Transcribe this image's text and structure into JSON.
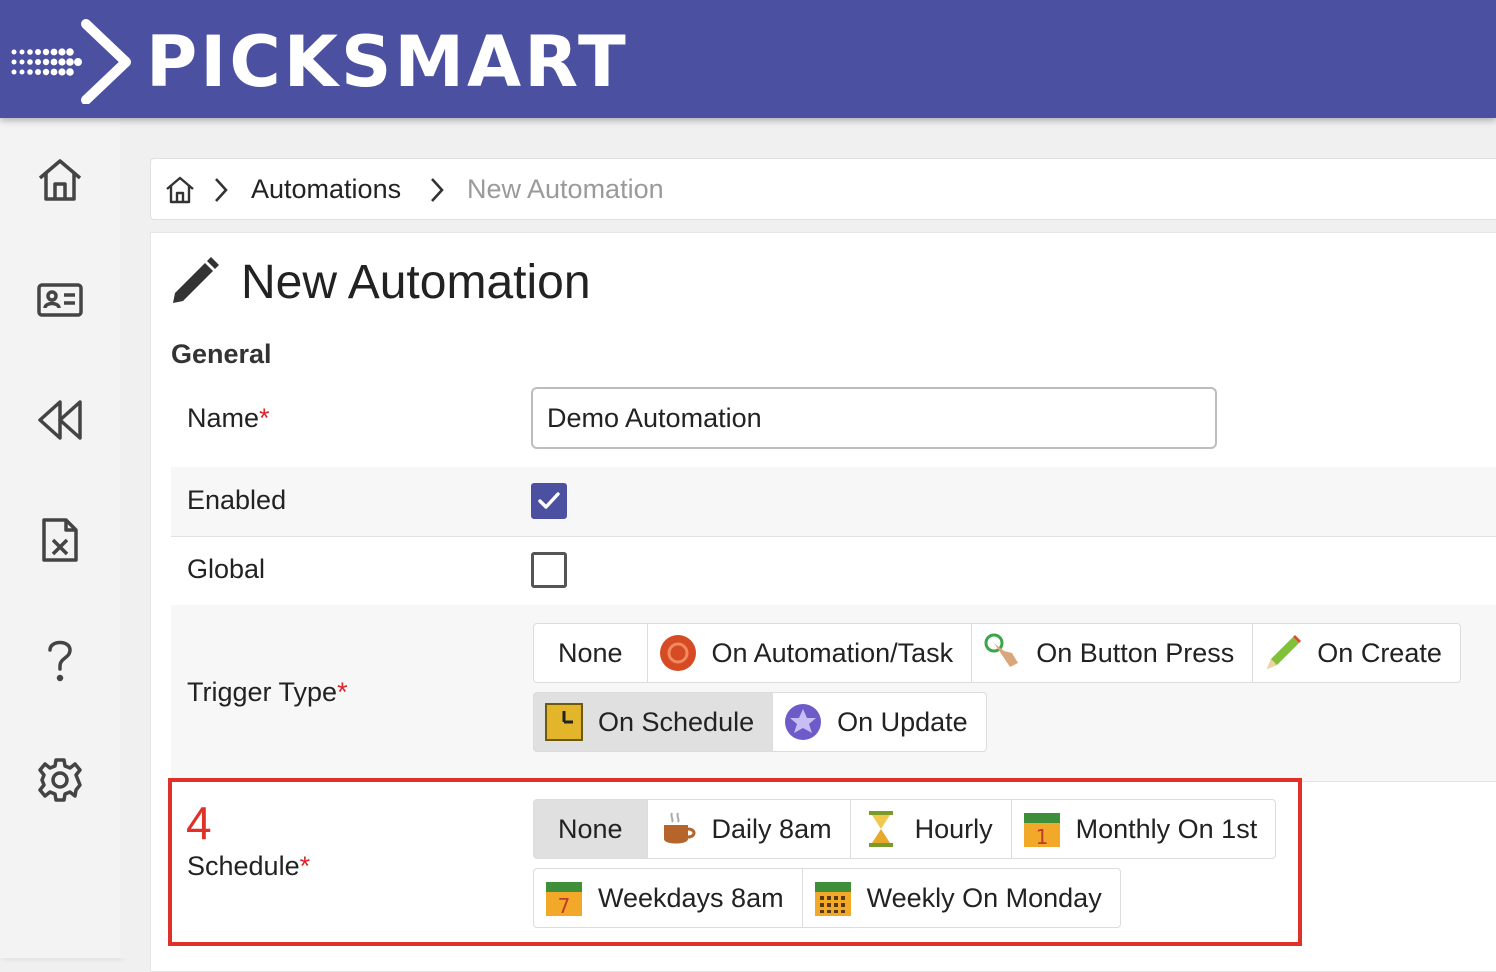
{
  "app": {
    "brand": "PICKSMART"
  },
  "sidebar": {
    "items": [
      {
        "icon": "home-icon"
      },
      {
        "icon": "id-card-icon"
      },
      {
        "icon": "rewind-icon"
      },
      {
        "icon": "excel-file-icon"
      },
      {
        "icon": "help-icon"
      },
      {
        "icon": "gear-icon"
      }
    ]
  },
  "breadcrumb": {
    "items": [
      "Automations",
      "New Automation"
    ]
  },
  "page": {
    "title": "New Automation",
    "section": "General"
  },
  "form": {
    "name_label": "Name",
    "name_value": "Demo Automation",
    "required_mark": "*",
    "enabled_label": "Enabled",
    "enabled": true,
    "global_label": "Global",
    "global": false,
    "trigger_label": "Trigger Type",
    "trigger_options": [
      {
        "label": "None",
        "icon": ""
      },
      {
        "label": "On Automation/Task",
        "icon": "record-icon"
      },
      {
        "label": "On Button Press",
        "icon": "hand-press-icon"
      },
      {
        "label": "On Create",
        "icon": "pencil-icon"
      },
      {
        "label": "On Schedule",
        "icon": "clock-icon",
        "selected": true
      },
      {
        "label": "On Update",
        "icon": "star-icon"
      }
    ],
    "schedule_label": "Schedule",
    "schedule_options": [
      {
        "label": "None",
        "icon": "",
        "selected": true
      },
      {
        "label": "Daily 8am",
        "icon": "coffee-icon"
      },
      {
        "label": "Hourly",
        "icon": "hourglass-icon"
      },
      {
        "label": "Monthly On 1st",
        "icon": "calendar-1-icon"
      },
      {
        "label": "Weekdays 8am",
        "icon": "calendar-7-icon"
      },
      {
        "label": "Weekly On Monday",
        "icon": "calendar-grid-icon"
      }
    ]
  },
  "annotation": {
    "step": "4",
    "color": "#e0302a"
  },
  "colors": {
    "header": "#4b51a0",
    "accent": "#4b51a0",
    "required": "#d9262b"
  }
}
